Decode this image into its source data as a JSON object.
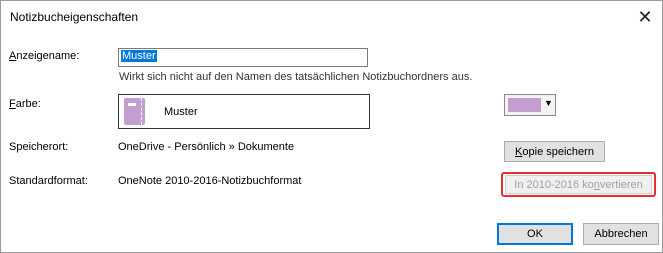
{
  "dialog": {
    "title": "Notizbucheigenschaften",
    "close_glyph": "✕"
  },
  "fields": {
    "display_name": {
      "label_underlined": "A",
      "label_rest": "nzeigename:",
      "value": "Muster",
      "hint": "Wirkt sich nicht auf den Namen des tatsächlichen Notizbuchordners aus."
    },
    "color": {
      "label_underlined": "F",
      "label_rest": "arbe:",
      "preview_name": "Muster",
      "swatch_color": "#c59ed1",
      "dropdown_glyph": "▼"
    },
    "location": {
      "label": "Speicherort:",
      "value": "OneDrive - Persönlich » Dokumente"
    },
    "default_format": {
      "label": "Standardformat:",
      "value": "OneNote 2010-2016-Notizbuchformat"
    }
  },
  "buttons": {
    "save_copy": {
      "underlined": "K",
      "rest": "opie speichern"
    },
    "convert": {
      "before": "In 2010-2016 ko",
      "underlined": "n",
      "after": "vertieren"
    },
    "ok": "OK",
    "cancel": "Abbrechen"
  },
  "colors": {
    "accent": "#0078d7",
    "highlight": "#e03030"
  }
}
